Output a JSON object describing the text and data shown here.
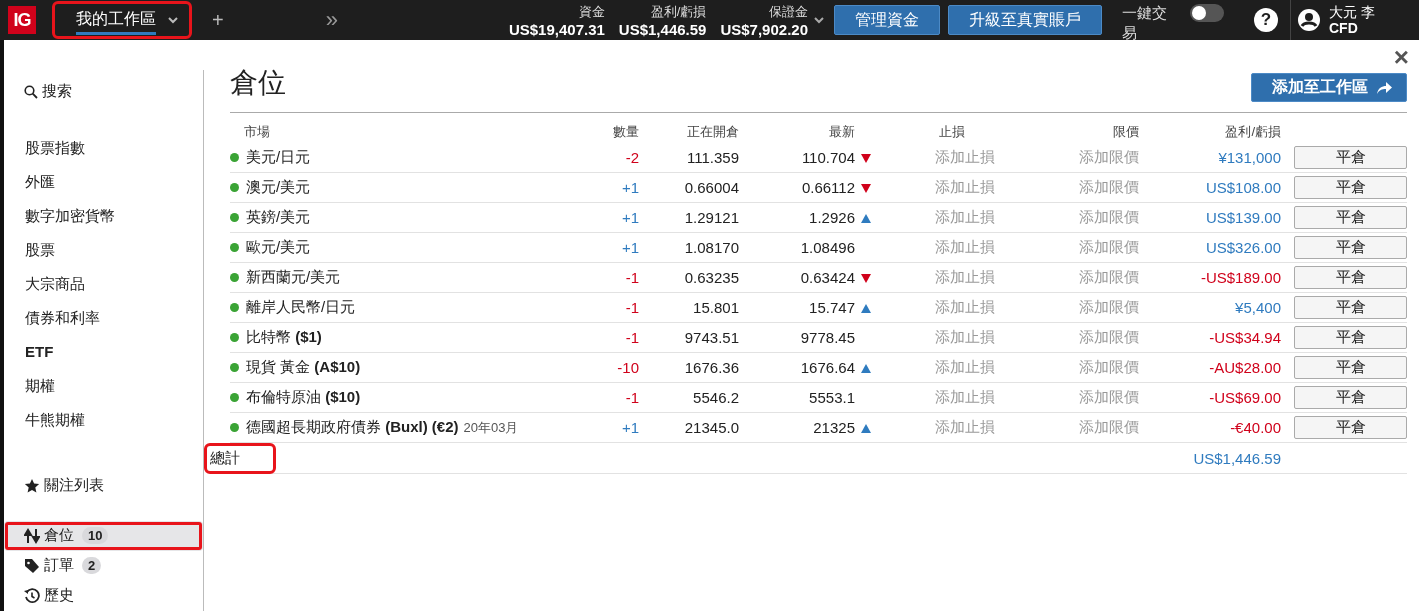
{
  "topbar": {
    "logo": "IG",
    "workspace_tab": {
      "label": "我的工作區",
      "selected": true,
      "highlighted": true
    },
    "add_tab": "+",
    "more": "»",
    "stats": [
      {
        "label": "資金",
        "value": "US$19,407.31"
      },
      {
        "label": "盈利/虧損",
        "value": "US$1,446.59"
      },
      {
        "label": "保證金",
        "value": "US$7,902.20"
      }
    ],
    "buttons": [
      "管理資金",
      "升級至真實賬戶"
    ],
    "one_click": {
      "label": "一鍵交易",
      "on": false
    },
    "help": "?",
    "user": {
      "name": "大元 李",
      "account": "CFD"
    }
  },
  "sidebar": {
    "search": "搜索",
    "categories": [
      "股票指數",
      "外匯",
      "數字加密貨幣",
      "股票",
      "大宗商品",
      "債券和利率",
      "ETF",
      "期權",
      "牛熊期權"
    ],
    "items": [
      {
        "kind": "watchlist",
        "label": "關注列表",
        "selected": false,
        "highlighted": false
      },
      {
        "kind": "positions",
        "label": "倉位",
        "badge": "10",
        "selected": true,
        "highlighted": true
      },
      {
        "kind": "orders",
        "label": "訂單",
        "badge": "2",
        "selected": false,
        "highlighted": false
      },
      {
        "kind": "history",
        "label": "歷史",
        "selected": false,
        "highlighted": false
      }
    ]
  },
  "panel": {
    "title": "倉位",
    "close": "×",
    "add_button": "添加至工作區",
    "columns": [
      "市場",
      "數量",
      "正在開倉",
      "最新",
      "止損",
      "限價",
      "盈利/虧損"
    ],
    "rows": [
      {
        "market": "美元/日元",
        "qty": "-2",
        "short": true,
        "open": "111.359",
        "latest": "110.704",
        "tick_up": false,
        "tick_down": true,
        "stop": "添加止損",
        "limit": "添加限價",
        "pnl": "¥131,000",
        "loss": false,
        "action": "平倉"
      },
      {
        "market": "澳元/美元",
        "qty": "+1",
        "short": false,
        "open": "0.66004",
        "latest": "0.66112",
        "tick_up": false,
        "tick_down": true,
        "stop": "添加止損",
        "limit": "添加限價",
        "pnl": "US$108.00",
        "loss": false,
        "action": "平倉"
      },
      {
        "market": "英鎊/美元",
        "qty": "+1",
        "short": false,
        "open": "1.29121",
        "latest": "1.2926",
        "tick_up": true,
        "tick_down": false,
        "stop": "添加止損",
        "limit": "添加限價",
        "pnl": "US$139.00",
        "loss": false,
        "action": "平倉"
      },
      {
        "market": "歐元/美元",
        "qty": "+1",
        "short": false,
        "open": "1.08170",
        "latest": "1.08496",
        "tick_up": false,
        "tick_down": false,
        "stop": "添加止損",
        "limit": "添加限價",
        "pnl": "US$326.00",
        "loss": false,
        "action": "平倉"
      },
      {
        "market": "新西蘭元/美元",
        "qty": "-1",
        "short": true,
        "open": "0.63235",
        "latest": "0.63424",
        "tick_up": false,
        "tick_down": true,
        "stop": "添加止損",
        "limit": "添加限價",
        "pnl": "-US$189.00",
        "loss": true,
        "action": "平倉"
      },
      {
        "market": "離岸人民幣/日元",
        "qty": "-1",
        "short": true,
        "open": "15.801",
        "latest": "15.747",
        "tick_up": true,
        "tick_down": false,
        "stop": "添加止損",
        "limit": "添加限價",
        "pnl": "¥5,400",
        "loss": false,
        "action": "平倉"
      },
      {
        "market": "比特幣 **($1)**",
        "qty": "-1",
        "short": true,
        "open": "9743.51",
        "latest": "9778.45",
        "tick_up": false,
        "tick_down": false,
        "stop": "添加止損",
        "limit": "添加限價",
        "pnl": "-US$34.94",
        "loss": true,
        "action": "平倉"
      },
      {
        "market": "現貨 黃金 **(A$10)**",
        "qty": "-10",
        "short": true,
        "open": "1676.36",
        "latest": "1676.64",
        "tick_up": true,
        "tick_down": false,
        "stop": "添加止損",
        "limit": "添加限價",
        "pnl": "-AU$28.00",
        "loss": true,
        "action": "平倉"
      },
      {
        "market": "布倫特原油 **($10)**",
        "qty": "-1",
        "short": true,
        "open": "5546.2",
        "latest": "5553.1",
        "tick_up": false,
        "tick_down": false,
        "stop": "添加止損",
        "limit": "添加限價",
        "pnl": "-US$69.00",
        "loss": true,
        "action": "平倉"
      },
      {
        "market": "德國超長期政府債券 **(Buxl) (€2)**",
        "expiry": "20年03月",
        "qty": "+1",
        "short": false,
        "open": "21345.0",
        "latest": "21325",
        "tick_up": true,
        "tick_down": false,
        "stop": "添加止損",
        "limit": "添加限價",
        "pnl": "-€40.00",
        "loss": true,
        "action": "平倉"
      }
    ],
    "total": {
      "label": "總計",
      "highlighted": true,
      "pnl": "US$1,446.59",
      "loss": false
    }
  }
}
